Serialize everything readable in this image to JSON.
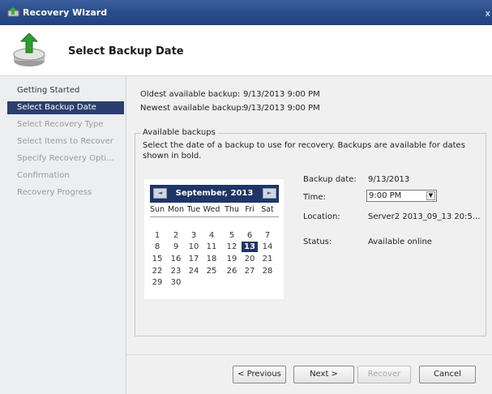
{
  "window": {
    "title": "Recovery Wizard",
    "close_glyph": "x",
    "app_icon": "recovery-wizard-icon"
  },
  "header": {
    "page_title": "Select Backup Date",
    "icon": "backup-restore-icon"
  },
  "nav": {
    "items": [
      {
        "label": "Getting Started",
        "state": "done"
      },
      {
        "label": "Select Backup Date",
        "state": "selected"
      },
      {
        "label": "Select Recovery Type",
        "state": "pending"
      },
      {
        "label": "Select Items to Recover",
        "state": "pending"
      },
      {
        "label": "Specify Recovery Opti...",
        "state": "pending"
      },
      {
        "label": "Confirmation",
        "state": "pending"
      },
      {
        "label": "Recovery Progress",
        "state": "pending"
      }
    ]
  },
  "summary": {
    "oldest_label": "Oldest available backup:",
    "oldest_value": "9/13/2013 9:00 PM",
    "newest_label": "Newest available backup:",
    "newest_value": "9/13/2013 9:00 PM"
  },
  "available": {
    "legend": "Available backups",
    "description": "Select the date of a backup to use for recovery. Backups are available for dates shown in bold."
  },
  "calendar": {
    "month_label": "September, 2013",
    "prev_glyph": "◄",
    "next_glyph": "►",
    "weekdays": [
      "Sun",
      "Mon",
      "Tue",
      "Wed",
      "Thu",
      "Fri",
      "Sat"
    ],
    "weeks": [
      [
        "1",
        "2",
        "3",
        "4",
        "5",
        "6",
        "7"
      ],
      [
        "8",
        "9",
        "10",
        "11",
        "12",
        "13",
        "14"
      ],
      [
        "15",
        "16",
        "17",
        "18",
        "19",
        "20",
        "21"
      ],
      [
        "22",
        "23",
        "24",
        "25",
        "26",
        "27",
        "28"
      ],
      [
        "29",
        "30",
        "",
        "",
        "",
        "",
        ""
      ]
    ],
    "selected_day": "13",
    "bold_days": [
      "13"
    ]
  },
  "details": {
    "backup_date_label": "Backup date:",
    "backup_date_value": "9/13/2013",
    "time_label": "Time:",
    "time_value": "9:00 PM",
    "location_label": "Location:",
    "location_value": "Server2 2013_09_13 20:5...",
    "status_label": "Status:",
    "status_value": "Available online"
  },
  "buttons": {
    "previous": "< Previous",
    "next": "Next >",
    "recover": "Recover",
    "cancel": "Cancel"
  },
  "colors": {
    "titlebar": "#2a4d8a",
    "selection": "#1f3566",
    "nav_selected": "#2a3f6f"
  }
}
